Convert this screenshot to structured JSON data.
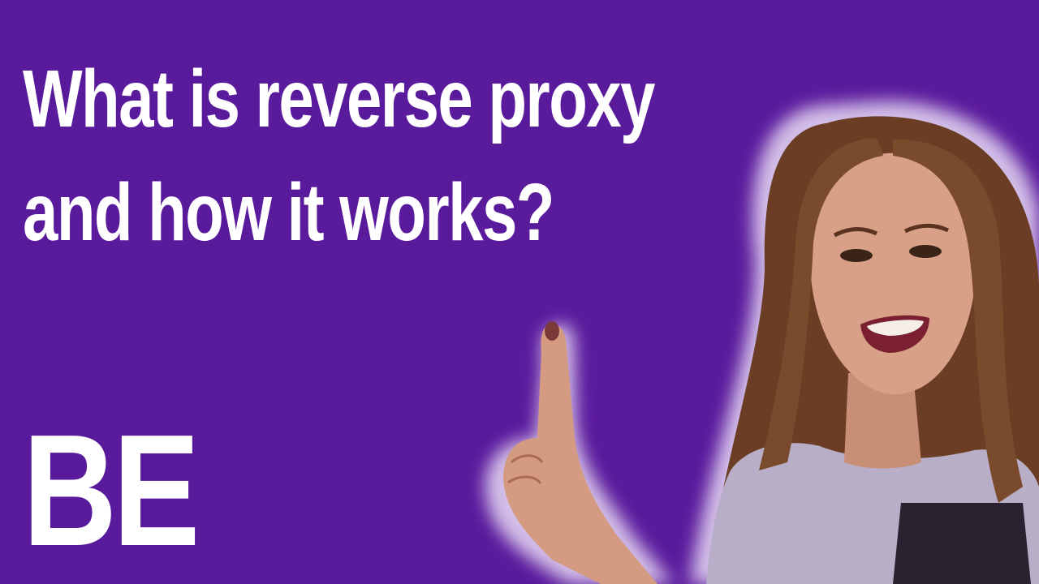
{
  "title": {
    "line1": "What is reverse proxy",
    "line2": "and how it works?"
  },
  "badge": "BE",
  "colors": {
    "background": "#5a1a9c",
    "text": "#ffffff",
    "glow": "#e8dcf5",
    "hair": "#7a4a2c",
    "skin": "#d9a088",
    "shirt": "#b8aec8",
    "lips": "#7a2030"
  },
  "illustration": {
    "subject": "presenter-pointing-up"
  }
}
